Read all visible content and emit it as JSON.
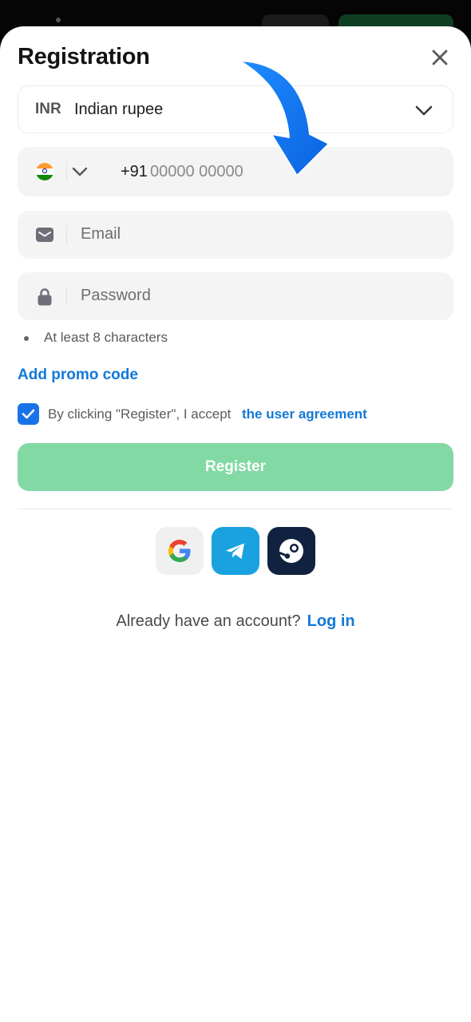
{
  "dialog": {
    "title": "Registration"
  },
  "currency": {
    "code": "INR",
    "name": "Indian rupee"
  },
  "phone": {
    "prefix": "+91",
    "placeholder": "00000 00000"
  },
  "email": {
    "placeholder": "Email"
  },
  "password": {
    "placeholder": "Password",
    "hint": "At least 8 characters"
  },
  "promo": {
    "label": "Add promo code"
  },
  "agreement": {
    "checked": true,
    "text": "By clicking \"Register\", I accept",
    "link": "the user agreement"
  },
  "register": {
    "label": "Register"
  },
  "social": {
    "icons": [
      "google-icon",
      "telegram-icon",
      "steam-icon"
    ]
  },
  "login": {
    "question": "Already have an account?",
    "link": "Log in"
  },
  "colors": {
    "accent": "#1279d8",
    "register_bg": "#82d9a4",
    "checkbox": "#1a72e8",
    "field_bg": "#f4f4f4",
    "arrow": "#1478f0"
  }
}
